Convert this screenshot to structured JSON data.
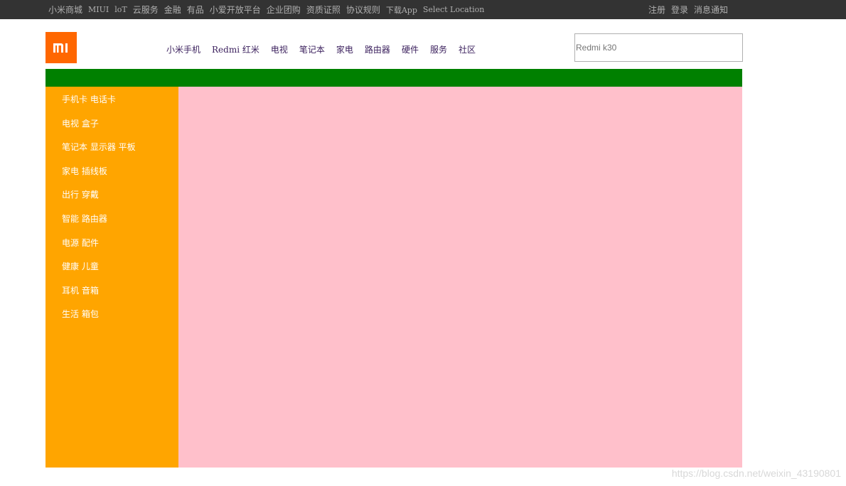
{
  "topbar": {
    "left_links": [
      {
        "label": "小米商城",
        "serif": false
      },
      {
        "label": "MIUI",
        "serif": true
      },
      {
        "label": "loT",
        "serif": true
      },
      {
        "label": "云服务",
        "serif": false
      },
      {
        "label": "金融",
        "serif": false
      },
      {
        "label": "有品",
        "serif": false
      },
      {
        "label": "小爱开放平台",
        "serif": false
      },
      {
        "label": "企业团购",
        "serif": false
      },
      {
        "label": "资质证照",
        "serif": false
      },
      {
        "label": "协议规则",
        "serif": false
      },
      {
        "label": "下载App",
        "serif": true
      },
      {
        "label": "Select Location",
        "serif": true
      }
    ],
    "right_links": [
      "注册",
      "登录",
      "消息通知"
    ]
  },
  "logo": {
    "alt": "mi"
  },
  "nav": {
    "items": [
      "小米手机",
      "Redmi 红米",
      "电视",
      "笔记本",
      "家电",
      "路由器",
      "硬件",
      "服务",
      "社区"
    ]
  },
  "search": {
    "placeholder": "Redmi k30"
  },
  "sidebar": {
    "items": [
      "手机卡 电话卡",
      "电视 盒子",
      "笔记本 显示器 平板",
      "家电 插线板",
      "出行 穿戴",
      "智能 路由器",
      "电源 配件",
      "健康 儿童",
      "耳机 音箱",
      "生活 箱包"
    ]
  },
  "watermark": "https://blog.csdn.net/weixin_43190801",
  "colors": {
    "topbar": "#333333",
    "logo": "#ff6700",
    "greenbar": "#008000",
    "sidebar": "#ffa500",
    "content": "#ffc0cb"
  }
}
